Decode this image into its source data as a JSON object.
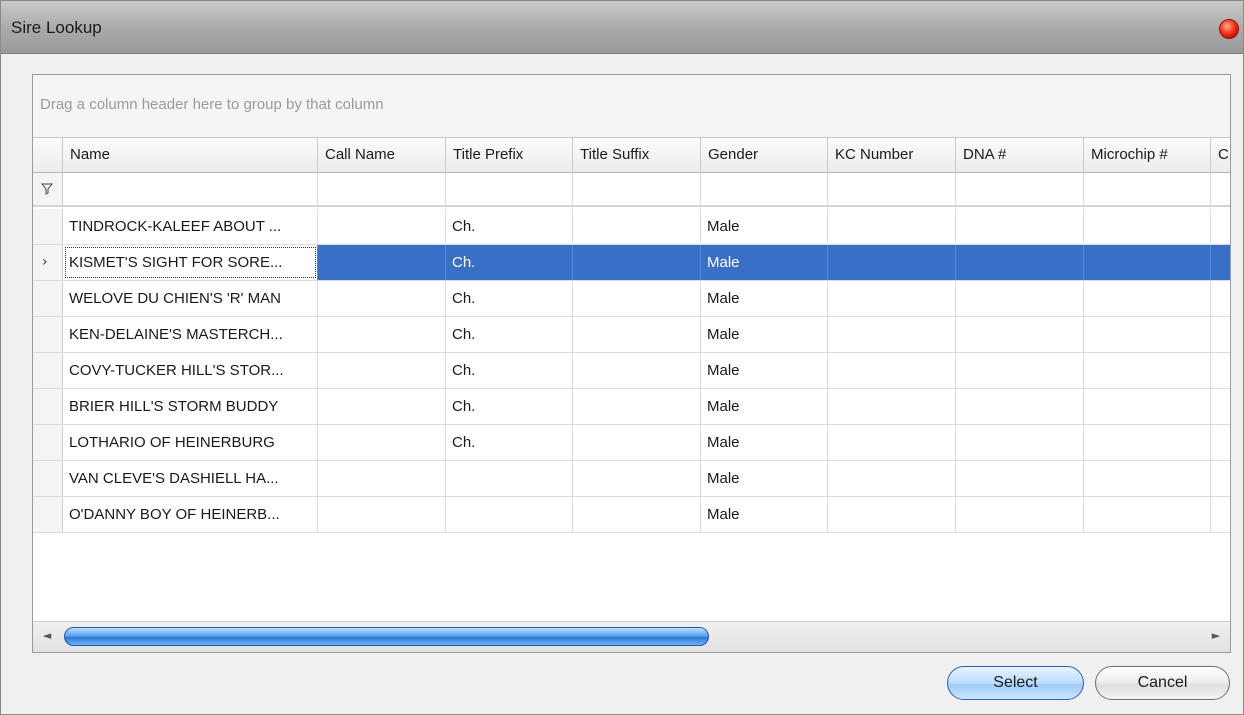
{
  "window": {
    "title": "Sire Lookup"
  },
  "group_panel": {
    "hint": "Drag a column header here to group by that column"
  },
  "columns": [
    "Name",
    "Call Name",
    "Title Prefix",
    "Title Suffix",
    "Gender",
    "KC Number",
    "DNA #",
    "Microchip #",
    "C"
  ],
  "rows": [
    {
      "name": "TINDROCK-KALEEF ABOUT ...",
      "call_name": "",
      "title_prefix": "Ch.",
      "title_suffix": "",
      "gender": "Male",
      "kc_number": "",
      "dna": "",
      "microchip": ""
    },
    {
      "name": "KISMET'S SIGHT FOR SORE...",
      "call_name": "",
      "title_prefix": "Ch.",
      "title_suffix": "",
      "gender": "Male",
      "kc_number": "",
      "dna": "",
      "microchip": "",
      "selected": true
    },
    {
      "name": "WELOVE DU CHIEN'S 'R' MAN",
      "call_name": "",
      "title_prefix": "Ch.",
      "title_suffix": "",
      "gender": "Male",
      "kc_number": "",
      "dna": "",
      "microchip": ""
    },
    {
      "name": "KEN-DELAINE'S MASTERCH...",
      "call_name": "",
      "title_prefix": "Ch.",
      "title_suffix": "",
      "gender": "Male",
      "kc_number": "",
      "dna": "",
      "microchip": ""
    },
    {
      "name": "COVY-TUCKER HILL'S STOR...",
      "call_name": "",
      "title_prefix": "Ch.",
      "title_suffix": "",
      "gender": "Male",
      "kc_number": "",
      "dna": "",
      "microchip": ""
    },
    {
      "name": "BRIER HILL'S STORM BUDDY",
      "call_name": "",
      "title_prefix": "Ch.",
      "title_suffix": "",
      "gender": "Male",
      "kc_number": "",
      "dna": "",
      "microchip": ""
    },
    {
      "name": "LOTHARIO OF HEINERBURG",
      "call_name": "",
      "title_prefix": "Ch.",
      "title_suffix": "",
      "gender": "Male",
      "kc_number": "",
      "dna": "",
      "microchip": ""
    },
    {
      "name": "VAN CLEVE'S DASHIELL HA...",
      "call_name": "",
      "title_prefix": "",
      "title_suffix": "",
      "gender": "Male",
      "kc_number": "",
      "dna": "",
      "microchip": ""
    },
    {
      "name": "O'DANNY BOY OF HEINERB...",
      "call_name": "",
      "title_prefix": "",
      "title_suffix": "",
      "gender": "Male",
      "kc_number": "",
      "dna": "",
      "microchip": ""
    }
  ],
  "row_indicator": {
    "current": "›"
  },
  "scrollbar": {
    "left_arrow": "◄",
    "right_arrow": "►"
  },
  "buttons": {
    "select": "Select",
    "cancel": "Cancel"
  },
  "colors": {
    "selection": "#3a6fc7",
    "title_close": "#e02000"
  }
}
